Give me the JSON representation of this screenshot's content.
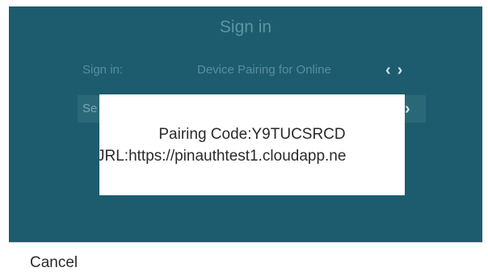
{
  "screen": {
    "title": "Sign in",
    "rows": [
      {
        "label": "Sign in:",
        "value": "Device Pairing for Online"
      },
      {
        "label": "Se"
      }
    ],
    "arrow_left": "‹",
    "arrow_right": "›"
  },
  "dialog": {
    "pairing_code": "Pairing Code:Y9TUCSRCD",
    "url": "JRL:https://pinauthtest1.cloudapp.ne"
  },
  "softkeys": {
    "cancel": "Cancel"
  },
  "colors": {
    "screen_bg": "#1c5c6e",
    "dialog_bg": "#ffffff"
  }
}
